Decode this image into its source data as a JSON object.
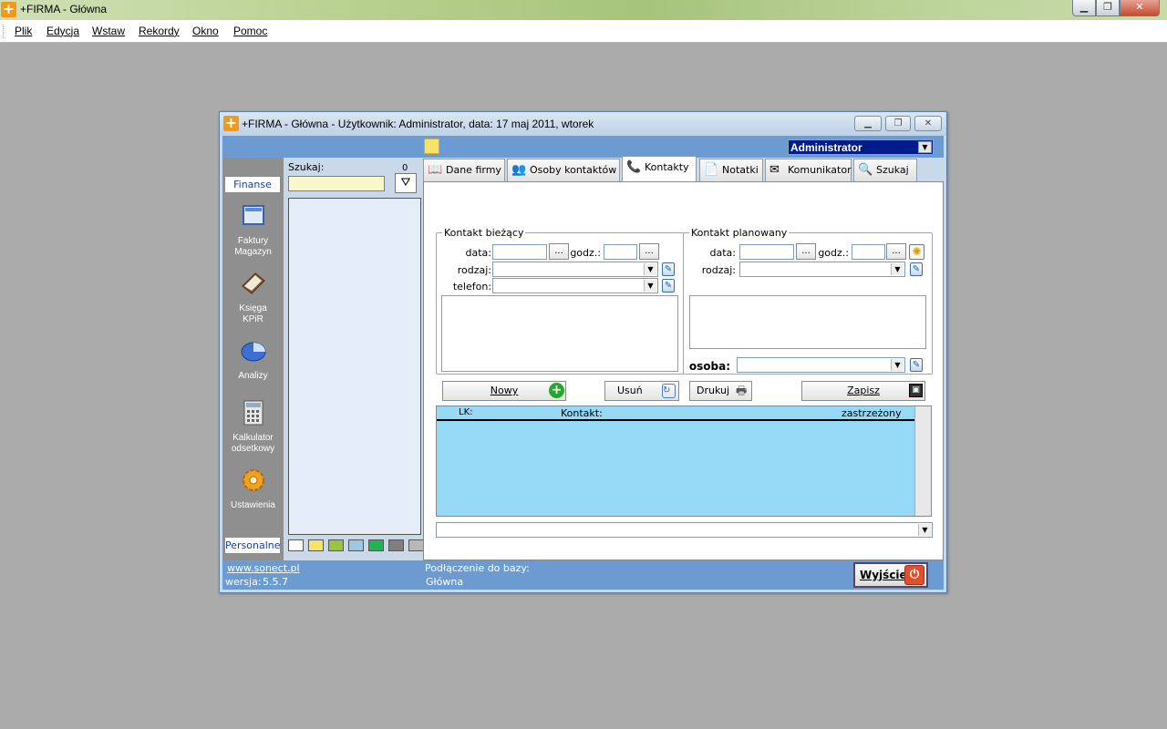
{
  "app": {
    "title": "+FIRMA - Główna",
    "logo": "+",
    "min": "▁",
    "max": "❐",
    "close": "✕"
  },
  "menu": [
    "Plik",
    "Edycja",
    "Wstaw",
    "Rekordy",
    "Okno",
    "Pomoc"
  ],
  "window": {
    "title": "+FIRMA - Główna - Użytkownik:  Administrator, data: 17 maj 2011, wtorek",
    "user_combo": "Administrator"
  },
  "sidebar": {
    "top_tab": "Finanse",
    "bottom_tab": "Personalne",
    "items": [
      {
        "label1": "Faktury",
        "label2": "Magazyn",
        "icon": "invoice-icon"
      },
      {
        "label1": "Księga",
        "label2": "KPiR",
        "icon": "book-icon"
      },
      {
        "label1": "Analizy",
        "label2": "",
        "icon": "pie-chart-icon"
      },
      {
        "label1": "Kalkulator",
        "label2": "odsetkowy",
        "icon": "calculator-icon"
      },
      {
        "label1": "Ustawienia",
        "label2": "",
        "icon": "gear-icon"
      }
    ]
  },
  "list": {
    "search_label": "Szukaj:",
    "count": "0",
    "swatches": [
      "#ffffff",
      "#f3e46b",
      "#99c443",
      "#9ac8e6",
      "#1fb456",
      "#7f7f7f",
      "#b8b8b8"
    ]
  },
  "tabs": [
    {
      "label": "Dane firmy",
      "icon": "📖"
    },
    {
      "label": "Osoby kontaktów",
      "icon": "👥"
    },
    {
      "label": "Kontakty",
      "icon": "📞"
    },
    {
      "label": "Notatki",
      "icon": "📄"
    },
    {
      "label": "Komunikator",
      "icon": "✉"
    },
    {
      "label": "Szukaj",
      "icon": "🔍"
    }
  ],
  "kontakt_biezacy": {
    "legend": "Kontakt bieżący",
    "data_label": "data:",
    "godz_label": "godz.:",
    "rodzaj_label": "rodzaj:",
    "telefon_label": "telefon:",
    "dots": "..."
  },
  "kontakt_planowany": {
    "legend": "Kontakt planowany",
    "data_label": "data:",
    "godz_label": "godz.:",
    "rodzaj_label": "rodzaj:",
    "osoba_label": "osoba:"
  },
  "buttons": {
    "nowy": "Nowy",
    "usun": "Usuń",
    "drukuj": "Drukuj",
    "zapisz": "Zapisz"
  },
  "grid": {
    "col_lk": "LK:",
    "col_kontakt": "Kontakt:",
    "col_zastrzezony": "zastrzeżony"
  },
  "status": {
    "link": "www.sonect.pl",
    "version_label": "wersja:",
    "version": "5.5.7",
    "db_label": "Podłączenie do bazy:",
    "db_name": "Główna",
    "exit": "Wyjście"
  }
}
